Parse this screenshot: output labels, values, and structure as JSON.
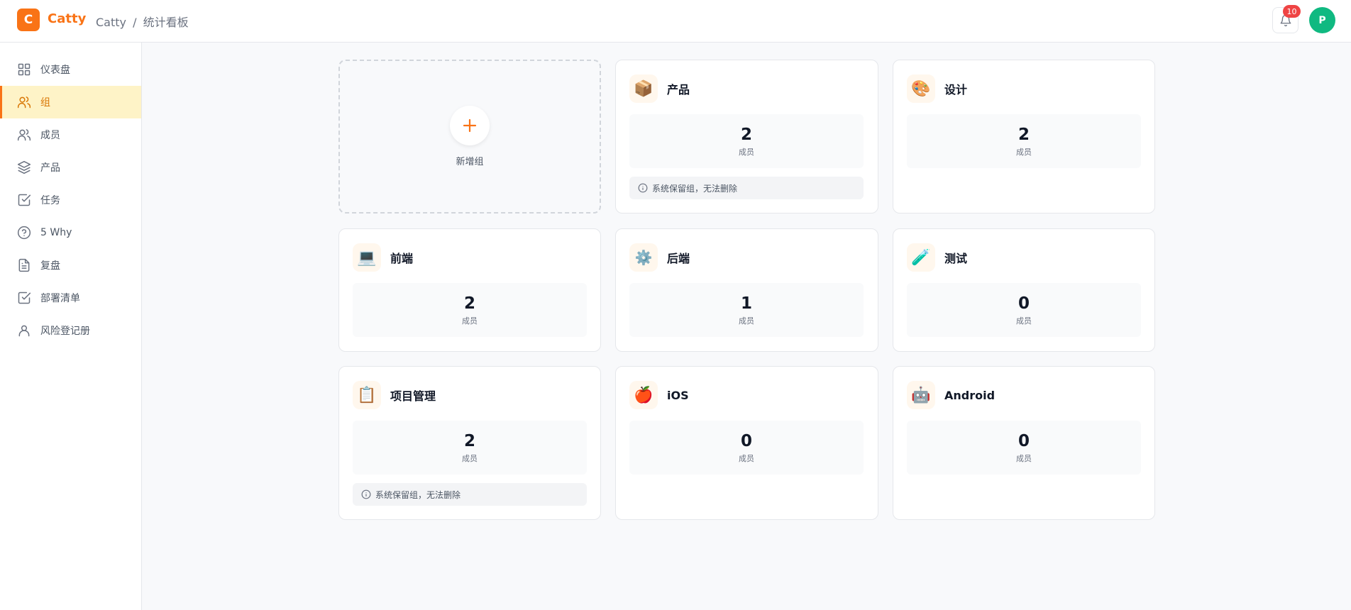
{
  "header": {
    "logo_letter": "C",
    "brand": "Catty",
    "breadcrumb_root": "Catty",
    "breadcrumb_sep": "/",
    "breadcrumb_current": "统计看板",
    "notification_count": "10",
    "avatar_initial": "P"
  },
  "sidebar": {
    "items": [
      {
        "label": "仪表盘",
        "icon": "grid-icon"
      },
      {
        "label": "组",
        "icon": "users-icon"
      },
      {
        "label": "成员",
        "icon": "users-icon"
      },
      {
        "label": "产品",
        "icon": "layers-icon"
      },
      {
        "label": "任务",
        "icon": "check-square-icon"
      },
      {
        "label": "5 Why",
        "icon": "help-circle-icon"
      },
      {
        "label": "复盘",
        "icon": "file-text-icon"
      },
      {
        "label": "部署清单",
        "icon": "check-square-icon"
      },
      {
        "label": "风险登记册",
        "icon": "user-icon"
      }
    ],
    "active_index": 1
  },
  "add_card": {
    "label": "新增组"
  },
  "member_label": "成员",
  "reserved_note": "系统保留组，无法删除",
  "groups": [
    {
      "name": "产品",
      "emoji": "📦",
      "members": "2",
      "reserved": true
    },
    {
      "name": "设计",
      "emoji": "🎨",
      "members": "2",
      "reserved": false
    },
    {
      "name": "前端",
      "emoji": "💻",
      "members": "2",
      "reserved": false
    },
    {
      "name": "后端",
      "emoji": "⚙️",
      "members": "1",
      "reserved": false
    },
    {
      "name": "测试",
      "emoji": "🧪",
      "members": "0",
      "reserved": false
    },
    {
      "name": "项目管理",
      "emoji": "📋",
      "members": "2",
      "reserved": true
    },
    {
      "name": "iOS",
      "emoji": "🍎",
      "members": "0",
      "reserved": false
    },
    {
      "name": "Android",
      "emoji": "🤖",
      "members": "0",
      "reserved": false
    }
  ],
  "colors": {
    "accent": "#f97316",
    "active_bg": "#fef3c7",
    "badge": "#ef4444",
    "avatar": "#10b981"
  }
}
